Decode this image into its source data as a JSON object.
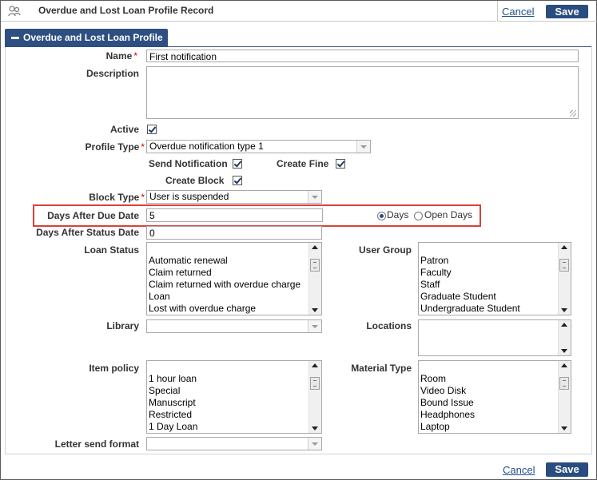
{
  "header": {
    "title": "Overdue and Lost Loan Profile Record",
    "cancel_label": "Cancel",
    "save_label": "Save"
  },
  "section": {
    "title": "Overdue and Lost Loan Profile"
  },
  "form": {
    "name": {
      "label": "Name",
      "required_mark": "*",
      "value": "First notification"
    },
    "description": {
      "label": "Description",
      "value": ""
    },
    "active": {
      "label": "Active",
      "checked": true
    },
    "profile_type": {
      "label": "Profile Type",
      "required_mark": "*",
      "value": "Overdue notification type 1"
    },
    "send_notification": {
      "label": "Send Notification",
      "checked": true
    },
    "create_fine": {
      "label": "Create Fine",
      "checked": true
    },
    "create_block": {
      "label": "Create Block",
      "checked": true
    },
    "block_type": {
      "label": "Block Type",
      "required_mark": "*",
      "value": "User is suspended"
    },
    "days_after_due_date": {
      "label": "Days After Due Date",
      "value": "5"
    },
    "day_unit": {
      "options": [
        "Days",
        "Open Days"
      ],
      "selected": "Days"
    },
    "days_after_status_date": {
      "label": "Days After Status Date",
      "value": "0"
    },
    "loan_status": {
      "label": "Loan Status",
      "items": [
        "Automatic renewal",
        "Claim returned",
        "Claim returned with overdue charge",
        "Loan",
        "Lost with overdue charge"
      ]
    },
    "user_group": {
      "label": "User Group",
      "items": [
        "Patron",
        "Faculty",
        "Staff",
        "Graduate Student",
        "Undergraduate Student"
      ]
    },
    "library": {
      "label": "Library",
      "value": ""
    },
    "locations": {
      "label": "Locations",
      "value": ""
    },
    "item_policy": {
      "label": "Item policy",
      "items": [
        "1 hour loan",
        "Special",
        "Manuscript",
        "Restricted",
        "1 Day Loan"
      ]
    },
    "material_type": {
      "label": "Material Type",
      "items": [
        "Room",
        "Video Disk",
        "Bound Issue",
        "Headphones",
        "Laptop"
      ]
    },
    "letter_send_format": {
      "label": "Letter send format",
      "value": ""
    }
  },
  "footer": {
    "cancel_label": "Cancel",
    "save_label": "Save"
  },
  "colors": {
    "accent": "#2e4f82",
    "highlight": "#d9423c",
    "link": "#1f4e8c"
  }
}
